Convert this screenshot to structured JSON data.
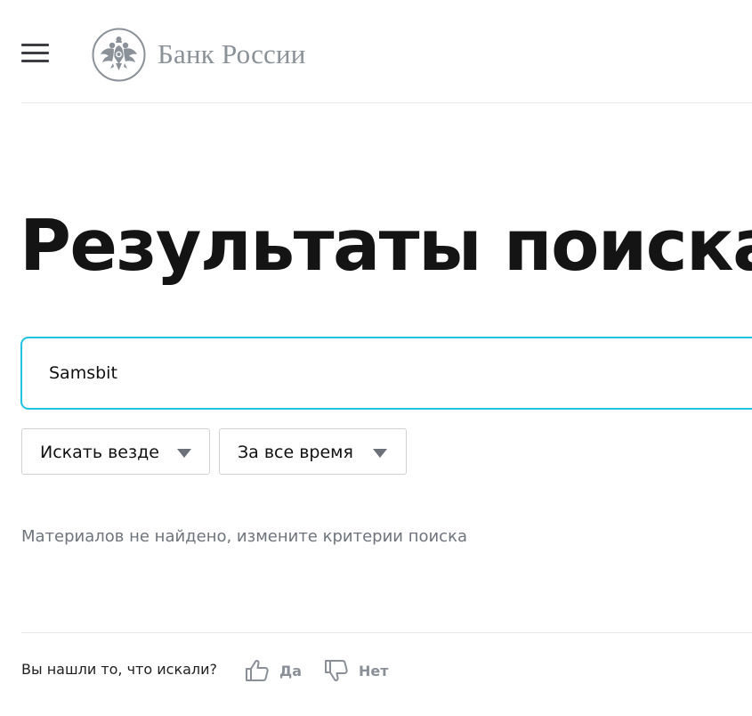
{
  "header": {
    "menu_icon": "hamburger-menu-icon",
    "logo_icon": "double-headed-eagle-emblem",
    "logo_text": "Банк России"
  },
  "main": {
    "title": "Результаты поиска",
    "search": {
      "value": "Samsbit"
    },
    "filters": [
      {
        "label": "Искать везде",
        "icon": "chevron-down-icon"
      },
      {
        "label": "За все время",
        "icon": "chevron-down-icon"
      }
    ],
    "empty_message": "Материалов не найдено, измените критерии поиска"
  },
  "feedback": {
    "question": "Вы нашли то, что искали?",
    "yes_label": "Да",
    "yes_icon": "thumbs-up-icon",
    "no_label": "Нет",
    "no_icon": "thumbs-down-icon"
  },
  "colors": {
    "accent": "#21c3e0",
    "muted_text": "#6f747c",
    "logo_gray": "#8b9199"
  }
}
